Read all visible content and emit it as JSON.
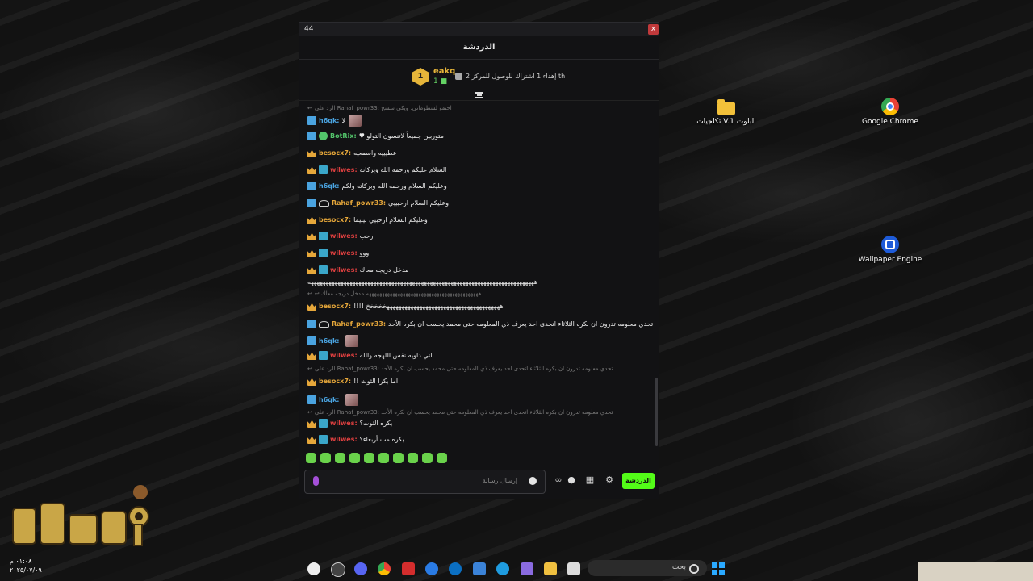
{
  "desktop": {
    "icons": [
      {
        "label": "تكلجيات V.1 البلوت",
        "icon": "folder-icon"
      },
      {
        "label": "Google Chrome",
        "icon": "chrome-icon"
      },
      {
        "label": "Wallpaper Engine",
        "icon": "wallpaper-engine-icon"
      }
    ]
  },
  "window": {
    "title": "44",
    "close_label": "x",
    "header_title": "الدردشة"
  },
  "hype": {
    "rank": "1",
    "username": "eakq",
    "count": "1",
    "message": "إهداء 1 اشتراك للوصول للمركز 2 th"
  },
  "messages": [
    {
      "type": "reply",
      "text": "الرد على Rahaf_powr33: احتفو لسطوماتي. ويكي سسح"
    },
    {
      "type": "msg",
      "user": "h6qk:",
      "color": "#4aa3e0",
      "text": "لا",
      "emote": true,
      "badges": [
        "b-sub"
      ]
    },
    {
      "type": "msg",
      "user": "BotRix:",
      "color": "#53c56b",
      "text": "متوربين جميعاً لاتنسون التولو ♥",
      "badges": [
        "b-sub",
        "b-bot"
      ]
    },
    {
      "type": "msg",
      "user": "besocx7:",
      "color": "#e6a73a",
      "text": "عطيييه واسمعيه",
      "badges": [
        "b-crown"
      ]
    },
    {
      "type": "msg",
      "user": "wilwes:",
      "color": "#e04040",
      "text": "السلام عليكم ورحمة الله وبركاته",
      "badges": [
        "b-crown",
        "b-vip"
      ]
    },
    {
      "type": "msg",
      "user": "h6qk:",
      "color": "#4aa3e0",
      "text": "وعليكم السلام ورحمه الله وبركاته ولكم",
      "badges": [
        "b-sub"
      ]
    },
    {
      "type": "msg",
      "user": "Rahaf_powr33:",
      "color": "#e6a73a",
      "text": "وعليكم السلام ارحبييي",
      "badges": [
        "b-sub",
        "b-og"
      ]
    },
    {
      "type": "msg",
      "user": "besocx7:",
      "color": "#e6a73a",
      "text": "وعليكم السلام ارحبيي بيبيما",
      "badges": [
        "b-crown"
      ]
    },
    {
      "type": "msg",
      "user": "wilwes:",
      "color": "#e04040",
      "text": "ارحب",
      "badges": [
        "b-crown",
        "b-vip"
      ]
    },
    {
      "type": "msg",
      "user": "wilwes:",
      "color": "#e04040",
      "text": "ووو",
      "badges": [
        "b-crown",
        "b-vip"
      ]
    },
    {
      "type": "msg",
      "user": "wilwes:",
      "color": "#e04040",
      "text": "مدخل دريجه معاك",
      "badges": [
        "b-crown",
        "b-vip"
      ]
    },
    {
      "type": "msg",
      "user": "",
      "color": "#ffffff",
      "text": "ههههههههههههههههههههههههههههههههههههههههههههههههههههههههههههههههههههههههههههه",
      "badges": []
    },
    {
      "type": "reply",
      "text": "↩ هههههههههههههههههههههههههههههههههههههههههههه مدخل دريجه معاك ..."
    },
    {
      "type": "msg",
      "user": "besocx7:",
      "color": "#e6a73a",
      "text": "هههههههههههههههههههههههههههههههههههههههخخخخخ !!!!",
      "badges": [
        "b-crown"
      ]
    },
    {
      "type": "msg",
      "user": "Rahaf_powr33:",
      "color": "#e6a73a",
      "text": "تحدي معلومه تدرون ان بكره الثلاثاء اتحدى احد يعرف ذي المعلومه حتى محمد يحسب ان بكره الأحد",
      "emote": true,
      "badges": [
        "b-sub",
        "b-og"
      ]
    },
    {
      "type": "msg",
      "user": "h6qk:",
      "color": "#4aa3e0",
      "text": "",
      "emote": true,
      "badges": [
        "b-sub"
      ]
    },
    {
      "type": "msg",
      "user": "wilwes:",
      "color": "#e04040",
      "text": "اني داويه نفس اللهجه والله",
      "badges": [
        "b-crown",
        "b-vip"
      ]
    },
    {
      "type": "reply",
      "text": "الرد على Rahaf_powr33: تحدي معلومه تدرون ان بكره الثلاثاء اتحدى احد يعرف ذي المعلومه حتى محمد يحسب ان بكره الأحد"
    },
    {
      "type": "msg",
      "user": "besocx7:",
      "color": "#e6a73a",
      "text": "اما بكرا الثوث !!",
      "badges": [
        "b-crown"
      ]
    },
    {
      "type": "msg",
      "user": "h6qk:",
      "color": "#4aa3e0",
      "text": "",
      "emote": true,
      "badges": [
        "b-sub"
      ]
    },
    {
      "type": "reply",
      "text": "الرد على Rahaf_powr33: تحدي معلومه تدرون ان بكره الثلاثاء اتحدى احد يعرف ذي المعلومه حتى محمد يحسب ان بكره الأحد"
    },
    {
      "type": "msg",
      "user": "wilwes:",
      "color": "#e04040",
      "text": "بكره الثوث؟",
      "badges": [
        "b-crown",
        "b-vip"
      ]
    },
    {
      "type": "msg",
      "user": "wilwes:",
      "color": "#e04040",
      "text": "بكره مب أربعاء؟",
      "badges": [
        "b-crown",
        "b-vip"
      ]
    }
  ],
  "input": {
    "placeholder": "إرسال رسالة",
    "send_label": "الدردشة"
  },
  "taskbar": {
    "search_placeholder": "بحث",
    "time": "٠١:٠٨ م",
    "date": "٢٠٢٥/٠٧/٠٩"
  }
}
